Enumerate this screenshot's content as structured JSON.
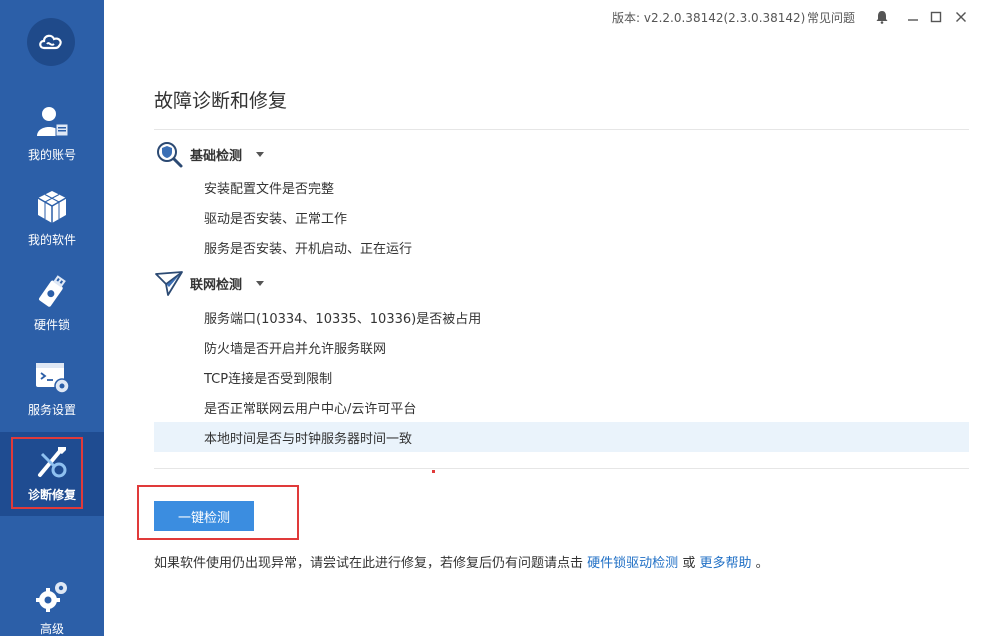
{
  "window": {
    "version": "版本: v2.2.0.38142(2.3.0.38142)",
    "faq_label": "常见问题"
  },
  "sidebar": {
    "items": [
      {
        "label": "我的账号",
        "icon": "user-icon"
      },
      {
        "label": "我的软件",
        "icon": "cube-icon"
      },
      {
        "label": "硬件锁",
        "icon": "usb-key-icon"
      },
      {
        "label": "服务设置",
        "icon": "service-settings-icon"
      },
      {
        "label": "诊断修复",
        "icon": "repair-tools-icon"
      },
      {
        "label": "高级",
        "icon": "gears-icon"
      }
    ],
    "active_index": 4
  },
  "main": {
    "title": "故障诊断和修复",
    "sections": [
      {
        "title": "基础检测",
        "icon": "magnifier-shield-icon",
        "items": [
          "安装配置文件是否完整",
          "驱动是否安装、正常工作",
          "服务是否安装、开机启动、正在运行"
        ]
      },
      {
        "title": "联网检测",
        "icon": "paper-plane-icon",
        "items": [
          "服务端口(10334、10335、10336)是否被占用",
          "防火墙是否开启并允许服务联网",
          "TCP连接是否受到限制",
          "是否正常联网云用户中心/云许可平台",
          "本地时间是否与时钟服务器时间一致"
        ]
      }
    ],
    "detect_button": "一键检测",
    "help": {
      "prefix": "如果软件使用仍出现异常，请尝试在此进行修复，若修复后仍有问题请点击",
      "link1": "硬件锁驱动检测",
      "connector": "或",
      "link2": "更多帮助",
      "suffix": "。"
    }
  },
  "colors": {
    "sidebar": "#2c5fa8",
    "accent": "#3b8de0",
    "link": "#1f6fc5",
    "highlight_row": "#eaf3fb",
    "annotation_red": "#e03a3a"
  }
}
